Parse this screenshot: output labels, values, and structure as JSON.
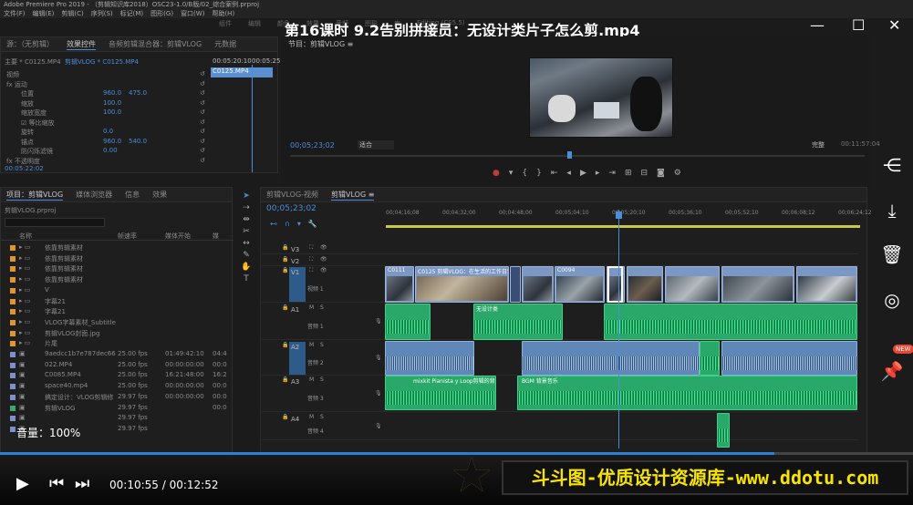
{
  "app": {
    "title_text": "Adobe Premiere Pro 2019 - （剪辑知识库2018）OSC23-1.0/B版/02_综合案例.prproj",
    "menu": [
      "文件(F)",
      "编辑(E)",
      "剪辑(C)",
      "序列(S)",
      "标记(M)",
      "图形(G)",
      "窗口(W)",
      "帮助(H)"
    ],
    "workspace_tabs": [
      "组件",
      "编辑",
      "颜色",
      "效果",
      "音频",
      "图形",
      "库",
      "Editing (CS5.5)"
    ]
  },
  "player": {
    "video_title": "第16课时 9.2告别拼接员：无设计类片子怎么剪.mp4",
    "volume_label": "音量：100%",
    "current_time": "00:10:55",
    "total_time": "00:12:52",
    "time_separator": " / ",
    "minimize": "—",
    "maximize": "☐",
    "close": "✕"
  },
  "source_panel": {
    "tabs": [
      "源：（无剪辑）",
      "效果控件",
      "音频剪辑混合器：剪辑VLOG",
      "元数据"
    ],
    "clip_header": "主要 * C0125.MP4",
    "clip_link": "剪辑VLOG * C0125.MP4",
    "timecode_start": "00:05:20:10",
    "timecode_end": "00:05:25",
    "clip_name_bar": "C0125.MP4",
    "rows": [
      {
        "label": "视频",
        "v1": "",
        "v2": ""
      },
      {
        "label": "fx 运动",
        "v1": "",
        "v2": ""
      },
      {
        "label": "位置",
        "v1": "960.0",
        "v2": "475.0"
      },
      {
        "label": "缩放",
        "v1": "100.0",
        "v2": ""
      },
      {
        "label": "缩放宽度",
        "v1": "100.0",
        "v2": ""
      },
      {
        "label": "☑ 等比缩放",
        "v1": "",
        "v2": ""
      },
      {
        "label": "旋转",
        "v1": "0.0",
        "v2": ""
      },
      {
        "label": "锚点",
        "v1": "960.0",
        "v2": "540.0"
      },
      {
        "label": "防闪烁滤镜",
        "v1": "0.00",
        "v2": ""
      },
      {
        "label": "fx 不透明度",
        "v1": "",
        "v2": ""
      }
    ],
    "bottom_timecode": "00:05:22:02"
  },
  "program_panel": {
    "header": "节目：剪辑VLOG ≡",
    "timecode": "00;05;23;02",
    "fit_label": "适合",
    "quality_label": "完整",
    "end_timecode": "00:11:57:04"
  },
  "project_panel": {
    "tabs": [
      "项目：剪辑VLOG",
      "媒体浏览器",
      "信息",
      "效果"
    ],
    "project_file": "剪辑VLOG.prproj",
    "search_placeholder": "",
    "columns": [
      "名称",
      "帧速率",
      "媒体开始",
      "媒"
    ],
    "items": [
      {
        "name": "依靠剪辑素材",
        "fps": "",
        "start": "",
        "extra": ""
      },
      {
        "name": "依靠剪辑素材",
        "fps": "",
        "start": "",
        "extra": ""
      },
      {
        "name": "依靠剪辑素材",
        "fps": "",
        "start": "",
        "extra": ""
      },
      {
        "name": "依靠剪辑素材",
        "fps": "",
        "start": "",
        "extra": ""
      },
      {
        "name": "V",
        "fps": "",
        "start": "",
        "extra": ""
      },
      {
        "name": "字幕21",
        "fps": "",
        "start": "",
        "extra": ""
      },
      {
        "name": "字幕21",
        "fps": "",
        "start": "",
        "extra": ""
      },
      {
        "name": "VLOG字幕素材_Subtitle_2",
        "fps": "",
        "start": "",
        "extra": ""
      },
      {
        "name": "剪辑VLOG封面.jpg",
        "fps": "",
        "start": "",
        "extra": ""
      },
      {
        "name": "片尾",
        "fps": "",
        "start": "",
        "extra": ""
      },
      {
        "name": "9aedcc1b7e787dec6617aa",
        "fps": "25.00 fps",
        "start": "01:49:42:10",
        "extra": "04:4"
      },
      {
        "name": "022.MP4",
        "fps": "25.00 fps",
        "start": "00:00:00:00",
        "extra": "00:0"
      },
      {
        "name": "C0085.MP4",
        "fps": "25.00 fps",
        "start": "16:21:48:00",
        "extra": "16:2"
      },
      {
        "name": "space40.mp4",
        "fps": "25.00 fps",
        "start": "00:00:00:00",
        "extra": "00:0"
      },
      {
        "name": "搞定设计：VLOG剪辑修",
        "fps": "29.97 fps",
        "start": "00:00:00:00",
        "extra": "00:0"
      },
      {
        "name": "剪辑VLOG",
        "fps": "29.97 fps",
        "start": "",
        "extra": "00:0"
      },
      {
        "name": "",
        "fps": "29.97 fps",
        "start": "",
        "extra": ""
      },
      {
        "name": "",
        "fps": "29.97 fps",
        "start": "",
        "extra": ""
      }
    ]
  },
  "timeline": {
    "tabs": [
      "剪辑VLOG-视频",
      "剪辑VLOG ≡"
    ],
    "timecode": "00;05;23;02",
    "ruler": [
      "00;04;16;08",
      "00;04;32;00",
      "00;04;48;00",
      "00;05;04;10",
      "00;05;20;10",
      "00;05;36;10",
      "00;05;52;10",
      "00;06;08;12",
      "00;06;24;12"
    ],
    "tracks": [
      {
        "id": "V3",
        "label": ""
      },
      {
        "id": "V2",
        "label": ""
      },
      {
        "id": "V1",
        "label": "视频 1"
      },
      {
        "id": "A1",
        "label": "音频 1"
      },
      {
        "id": "A2",
        "label": "音频 2"
      },
      {
        "id": "A3",
        "label": "音频 3"
      },
      {
        "id": "A4",
        "label": "音频 4"
      }
    ],
    "clip_labels": {
      "v1_a": "C0111",
      "v1_b": "C0125 剪辑VLOG：在生活的工作日常.mp4",
      "v1_c": "C0094",
      "a1_a": "无设计类",
      "a3_a": "mixkit Pianista y Loop剪辑的背景音乐.wav",
      "a3_b": "BGM 背景音乐"
    }
  },
  "sidebar": {
    "new_badge": "NEW"
  },
  "banner": {
    "text": "斗斗图-优质设计资源库-www.ddotu.com"
  }
}
